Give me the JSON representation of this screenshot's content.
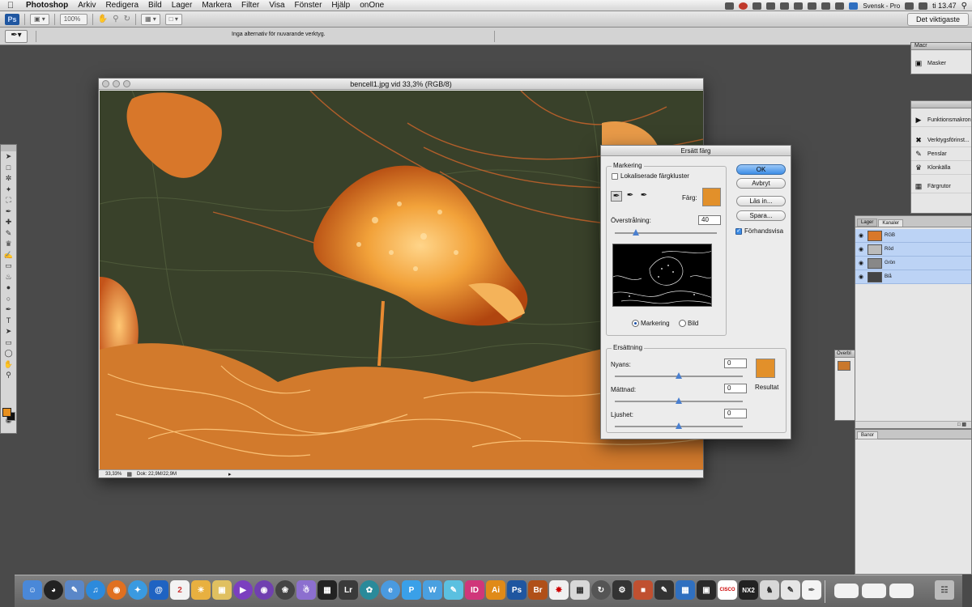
{
  "menubar": {
    "apple": "",
    "app_name": "Photoshop",
    "menus": [
      "Arkiv",
      "Redigera",
      "Bild",
      "Lager",
      "Markera",
      "Filter",
      "Visa",
      "Fönster",
      "Hjälp",
      "onOne"
    ],
    "input_source": "Svensk - Pro",
    "clock": "ti 13.47"
  },
  "appbar": {
    "ps_badge": "Ps",
    "zoom": "100%",
    "workspace": "Det viktigaste"
  },
  "optionsbar": {
    "message": "Inga alternativ för nuvarande verktyg."
  },
  "swatches": {
    "foreground": "#e8901e",
    "background": "#111111"
  },
  "document": {
    "title": "bencell1.jpg vid 33,3% (RGB/8)",
    "zoom": "33,33%",
    "doc_size": "Dok: 22,9M/22,9M"
  },
  "dialog": {
    "title": "Ersätt färg",
    "selection_group": "Markering",
    "localized_clusters": "Lokaliserade färgkluster",
    "color_label": "Färg:",
    "color_swatch": "#e2902a",
    "fuzziness_label": "Överstrålning:",
    "fuzziness_value": "40",
    "radio_selection": "Markering",
    "radio_image": "Bild",
    "replacement_group": "Ersättning",
    "hue_label": "Nyans:",
    "hue_value": "0",
    "saturation_label": "Mättnad:",
    "saturation_value": "0",
    "lightness_label": "Ljushet:",
    "lightness_value": "0",
    "result_label": "Resultat",
    "result_swatch": "#e2902a",
    "ok": "OK",
    "cancel": "Avbryt",
    "load": "Läs in...",
    "save": "Spara...",
    "preview": "Förhandsvisa"
  },
  "panels": {
    "masker_tab": "Macr",
    "masker": "Masker",
    "actions": "Funktionsmakron",
    "tool_presets": "Verktygsförinst...",
    "brushes": "Penslar",
    "clone_source": "Klonkälla",
    "swatches": "Färgrutor",
    "layers_tab": "Lager",
    "channels_tab": "Kanaler",
    "channels": [
      "RGB",
      "Röd",
      "Grön",
      "Blå"
    ],
    "navigator_tab": "Överbl",
    "paths_tab": "Banor"
  },
  "dock": {
    "lightroom": "Lr",
    "indesign": "ID",
    "illustrator": "Ai",
    "photoshop": "Ps",
    "bridge": "Br",
    "calendar_day": "2",
    "cisco": "CISCO",
    "nx2": "NX2"
  }
}
